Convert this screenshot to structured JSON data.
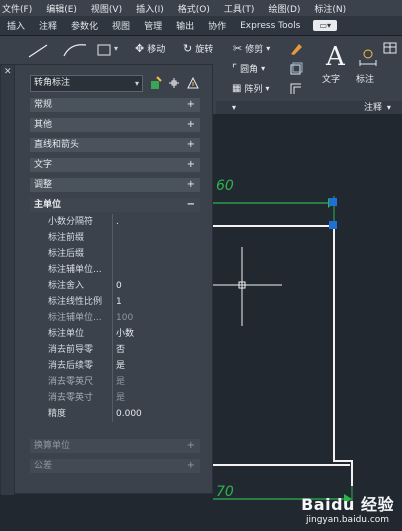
{
  "menubar": {
    "items": [
      "文件(F)",
      "编辑(E)",
      "视图(V)",
      "插入(I)",
      "格式(O)",
      "工具(T)",
      "绘图(D)",
      "标注(N)"
    ]
  },
  "ribbon_tabs": {
    "items": [
      "插入",
      "注释",
      "参数化",
      "视图",
      "管理",
      "输出",
      "协作",
      "Express Tools"
    ]
  },
  "ribbon": {
    "modify": {
      "move": "移动",
      "rotate": "旋转",
      "trim": "修剪",
      "fillet": "圆角",
      "array": "阵列"
    },
    "annotation": {
      "text_label": "文字",
      "dim_label": "标注",
      "panel_title": "注释"
    }
  },
  "palette": {
    "selector_value": "转角标注",
    "categories": [
      {
        "label": "常规",
        "expanded": false
      },
      {
        "label": "其他",
        "expanded": false
      },
      {
        "label": "直线和箭头",
        "expanded": false
      },
      {
        "label": "文字",
        "expanded": false
      },
      {
        "label": "调整",
        "expanded": false
      },
      {
        "label": "主单位",
        "expanded": true
      }
    ],
    "properties": [
      {
        "key": "小数分隔符",
        "value": "."
      },
      {
        "key": "标注前缀",
        "value": ""
      },
      {
        "key": "标注后缀",
        "value": ""
      },
      {
        "key": "标注辅单位...",
        "value": ""
      },
      {
        "key": "标注舍入",
        "value": "0"
      },
      {
        "key": "标注线性比例",
        "value": "1"
      },
      {
        "key": "标注辅单位...",
        "value": "100"
      },
      {
        "key": "标注单位",
        "value": "小数"
      },
      {
        "key": "消去前导零",
        "value": "否"
      },
      {
        "key": "消去后续零",
        "value": "是"
      },
      {
        "key": "消去零英尺",
        "value": "是"
      },
      {
        "key": "消去零英寸",
        "value": "是"
      },
      {
        "key": "精度",
        "value": "0.000"
      }
    ],
    "bottom_categories": [
      {
        "label": "换算单位",
        "expanded": false
      },
      {
        "label": "公差",
        "expanded": false
      }
    ],
    "expand_sign": "+",
    "collapse_sign": "−"
  },
  "drawing": {
    "dim_top": "60",
    "dim_bottom": "70"
  },
  "watermark": {
    "brand": "Baidu 经验",
    "site": "jingyan.baidu.com"
  },
  "colors": {
    "dimension": "#2db34d",
    "grip": "#1f6fd6",
    "geometry": "#f2f2f2"
  }
}
